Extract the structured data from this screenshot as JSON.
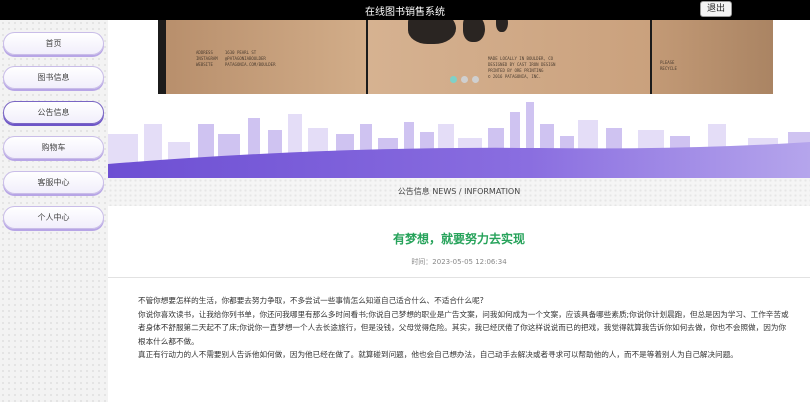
{
  "header": {
    "title": "在线图书销售系统",
    "logout_label": "退出"
  },
  "sidebar": {
    "items": [
      {
        "label": "首页"
      },
      {
        "label": "图书信息"
      },
      {
        "label": "公告信息"
      },
      {
        "label": "购物车"
      },
      {
        "label": "客服中心"
      },
      {
        "label": "个人中心"
      }
    ],
    "active_index": 2
  },
  "carousel": {
    "slide_text_left": "ADDRESS     1630 PEARL ST\nINSTAGRAM   @PATAGONIABOULDER\nWEBSITE     PATAGONIA.COM/BOULDER",
    "slide_text_mid": "MADE LOCALLY IN BOULDER, CO\nDESIGNED BY CAST IRON DESIGN\nPRINTED BY ORE PRINTING\n© 2016 PATAGONIA, INC.",
    "slide_text_right": "PLEASE\nRECYCLE",
    "dot_count": 3,
    "active_dot": 0
  },
  "colors": {
    "accent": "#27a35b",
    "purple": "#6d55c8",
    "banner_purple": "#7b5cd6"
  },
  "section": {
    "title": "公告信息 NEWS / INFORMATION"
  },
  "article": {
    "title": "有梦想，就要努力去实现",
    "time": "时间：2023-05-05 12:06:34",
    "paragraphs": [
      "不管你想要怎样的生活，你都要去努力争取，不多尝试一些事情怎么知道自己适合什么、不适合什么呢?",
      "你说你喜欢读书，让我给你列书单，你还问我哪里有那么多时间看书;你说自己梦想的职业是广告文案，问我如何成为一个文案，应该具备哪些素质;你说你计划晨跑，但总是因为学习、工作辛苦或者身体不舒服第二天起不了床;你说你一直梦想一个人去长途旅行，但是没钱，父母觉得危险。其实，我已经厌倦了你这样说说而已的把戏，我觉得就算我告诉你如何去做，你也不会照做，因为你根本什么都不做。",
      "真正有行动力的人不需要别人告诉他如何做，因为他已经在做了。就算碰到问题，他也会自己想办法，自己动手去解决或者寻求可以帮助他的人，而不是等着别人为自己解决问题。"
    ]
  }
}
